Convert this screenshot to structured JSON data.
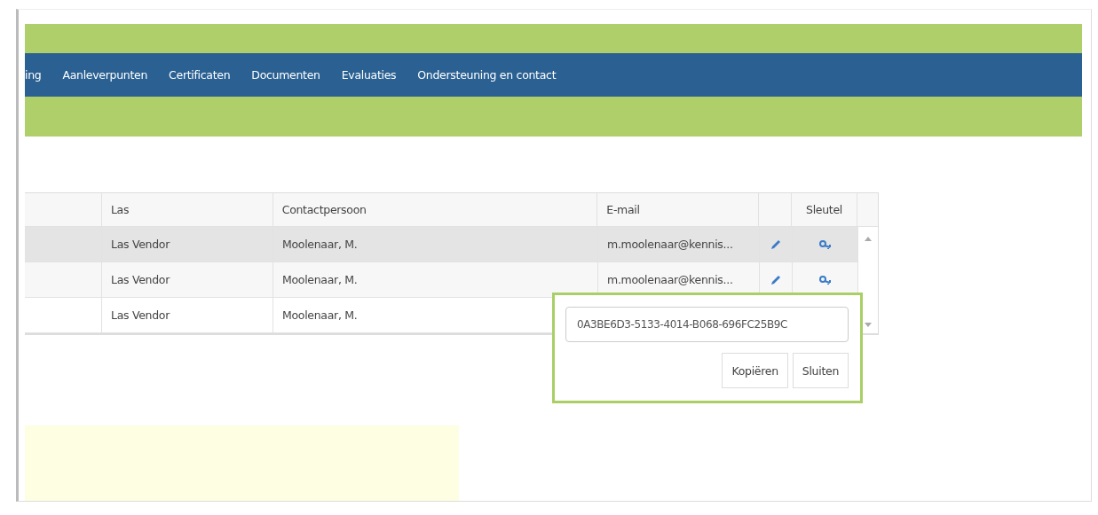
{
  "nav": {
    "items": [
      {
        "label": "ing"
      },
      {
        "label": "Aanleverpunten"
      },
      {
        "label": "Certificaten"
      },
      {
        "label": "Documenten"
      },
      {
        "label": "Evaluaties"
      },
      {
        "label": "Ondersteuning en contact"
      }
    ]
  },
  "table": {
    "columns": [
      "",
      "Las",
      "Contactpersoon",
      "E-mail",
      "",
      "Sleutel"
    ],
    "rows": [
      {
        "selected": true,
        "las": "Las Vendor",
        "contact": "Moolenaar, M.",
        "email": "m.moolenaar@kennis...",
        "actions": true
      },
      {
        "selected": false,
        "las": "Las Vendor",
        "contact": "Moolenaar, M.",
        "email": "m.moolenaar@kennis...",
        "actions": true
      },
      {
        "selected": false,
        "las": "Las Vendor",
        "contact": "Moolenaar, M."
      }
    ]
  },
  "key_popup": {
    "value": "0A3BE6D3-5133-4014-B068-696FC25B9C",
    "buttons": [
      "Kopiëren",
      "Sluiten"
    ]
  }
}
